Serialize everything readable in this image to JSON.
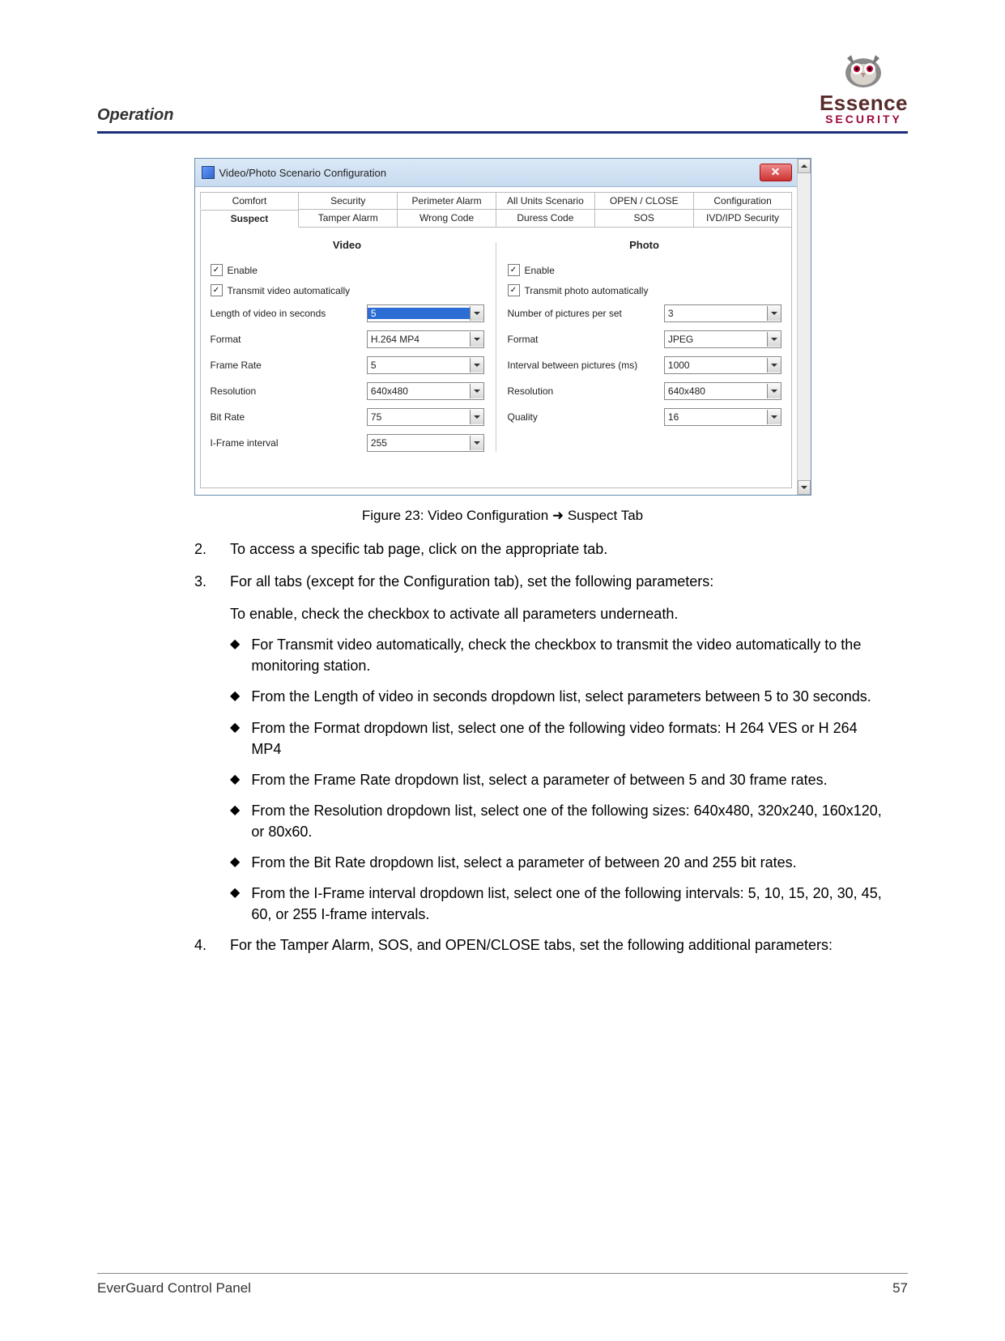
{
  "header": {
    "section": "Operation",
    "logo_main": "Essence",
    "logo_sub": "SECURITY"
  },
  "window": {
    "title": "Video/Photo Scenario Configuration",
    "tabs_row1": [
      "Comfort",
      "Security",
      "Perimeter Alarm",
      "All Units Scenario",
      "OPEN / CLOSE",
      "Configuration"
    ],
    "tabs_row2": [
      "Suspect",
      "Tamper Alarm",
      "Wrong Code",
      "Duress Code",
      "SOS",
      "IVD/IPD Security"
    ],
    "active_tab": "Suspect",
    "video": {
      "heading": "Video",
      "enable_label": "Enable",
      "enable_checked": true,
      "transmit_label": "Transmit video automatically",
      "transmit_checked": true,
      "fields": [
        {
          "label": "Length of video in seconds",
          "value": "5",
          "highlight": true
        },
        {
          "label": "Format",
          "value": "H.264 MP4"
        },
        {
          "label": "Frame Rate",
          "value": "5"
        },
        {
          "label": "Resolution",
          "value": "640x480"
        },
        {
          "label": "Bit Rate",
          "value": "75"
        },
        {
          "label": "I-Frame interval",
          "value": "255"
        }
      ]
    },
    "photo": {
      "heading": "Photo",
      "enable_label": "Enable",
      "enable_checked": true,
      "transmit_label": "Transmit photo automatically",
      "transmit_checked": true,
      "fields": [
        {
          "label": "Number of pictures per set",
          "value": "3"
        },
        {
          "label": "Format",
          "value": "JPEG"
        },
        {
          "label": "Interval between pictures (ms)",
          "value": "1000"
        },
        {
          "label": "Resolution",
          "value": "640x480"
        },
        {
          "label": "Quality",
          "value": "16"
        }
      ]
    }
  },
  "figure_caption": "Figure 23: Video Configuration ➜ Suspect Tab",
  "list": {
    "item2": {
      "num": "2.",
      "text": "To access a specific tab page, click on the appropriate tab."
    },
    "item3": {
      "num": "3.",
      "text": "For all tabs (except for the Configuration tab), set the following parameters:"
    },
    "item3_sub": "To enable, check the checkbox to activate all parameters underneath.",
    "bullets": [
      "For Transmit video automatically, check the checkbox to transmit the video automatically to the monitoring station.",
      "From the Length of video in seconds dropdown list, select parameters between 5 to 30 seconds.",
      "From the Format dropdown list, select one of the following video formats: H 264 VES or H 264 MP4",
      "From the Frame Rate dropdown list, select a parameter of between 5 and 30 frame rates.",
      "From the Resolution dropdown list, select one of the following sizes: 640x480, 320x240, 160x120, or 80x60.",
      "From the Bit Rate dropdown list, select a parameter of between 20 and 255 bit rates.",
      "From the I-Frame interval dropdown list, select one of the following intervals: 5, 10, 15, 20, 30, 45, 60, or 255 I-frame intervals."
    ],
    "item4": {
      "num": "4.",
      "text": "For the Tamper Alarm, SOS, and OPEN/CLOSE tabs, set the following additional parameters:"
    }
  },
  "footer": {
    "left": "EverGuard Control Panel",
    "right": "57"
  }
}
